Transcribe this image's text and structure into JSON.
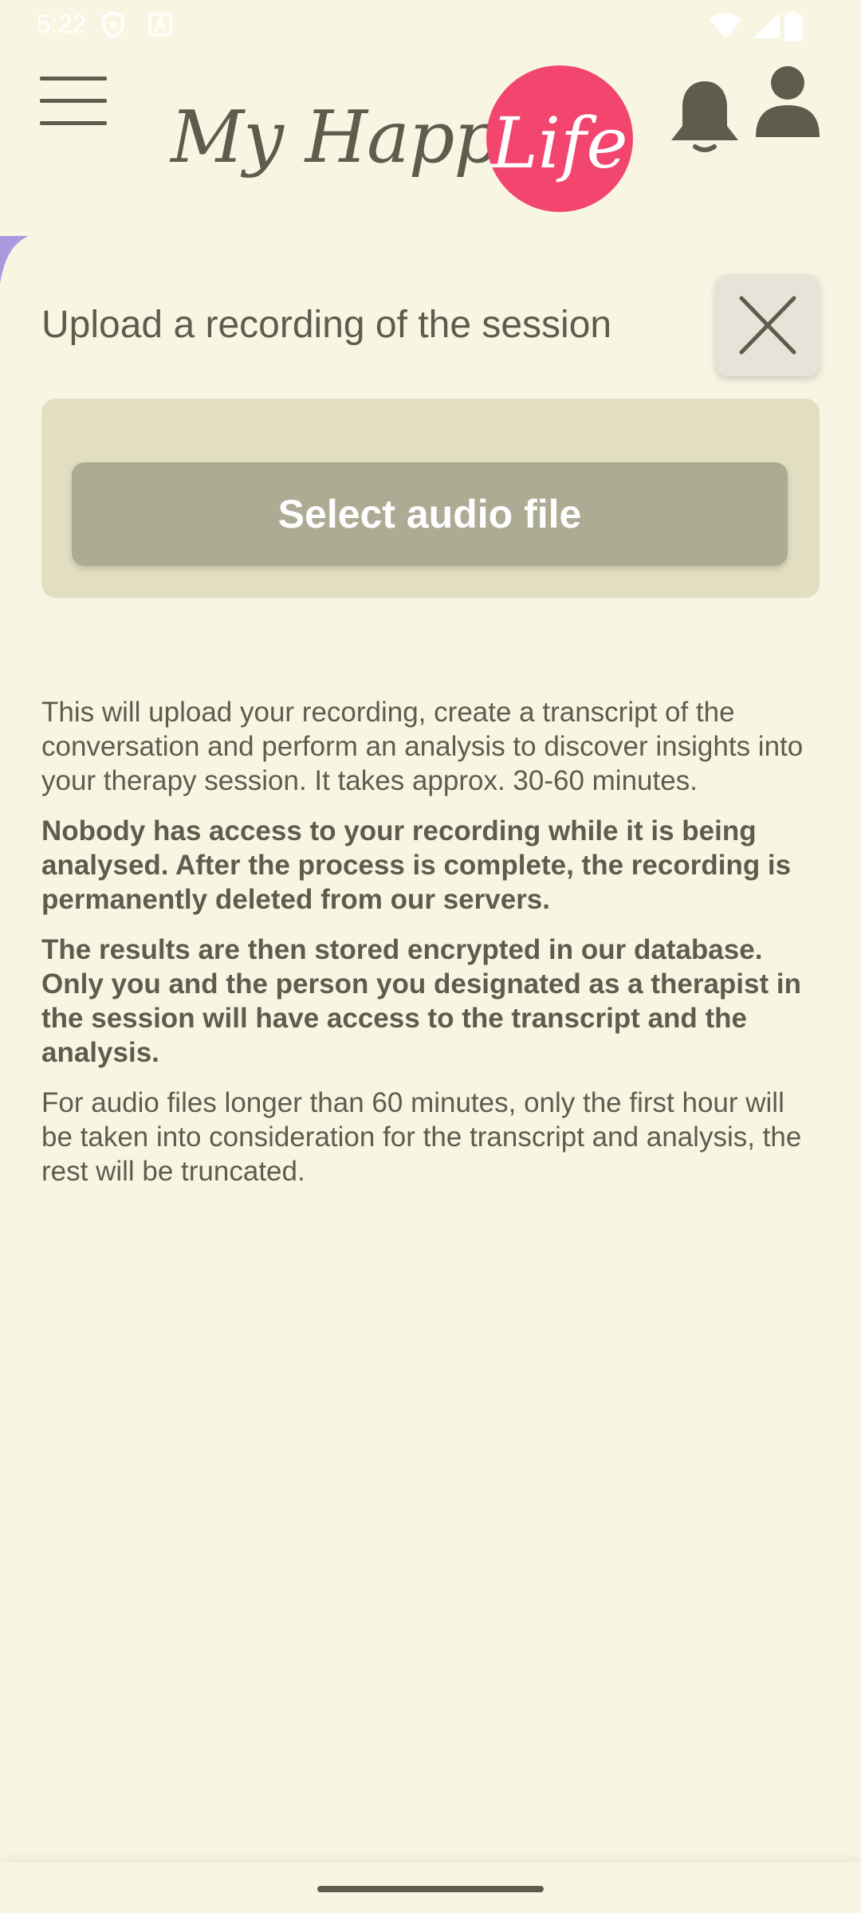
{
  "status_bar": {
    "time": "5:22",
    "icons": [
      "shield-icon",
      "a-icon",
      "wifi-icon",
      "signal-icon",
      "battery-icon"
    ]
  },
  "header": {
    "menu_icon": "hamburger-menu-icon",
    "logo_text": "My Happier",
    "logo_badge_text": "Life",
    "notifications_icon": "bell-icon",
    "profile_icon": "person-icon"
  },
  "panel": {
    "title": "Upload a recording of the session",
    "close_icon": "close-icon",
    "select_button_label": "Select audio file"
  },
  "description": {
    "p1": "This will upload your recording, create a transcript of the conversation and perform an analysis to discover insights into your therapy session. It takes approx. 30-60 minutes.",
    "p2": "Nobody has access to your recording while it is being analysed. After the process is complete, the recording is permanently deleted from our servers.",
    "p3": "The results are then stored encrypted in our database. Only you and the person you designated as a therapist in the session will have access to the transcript and the analysis.",
    "p4": "For audio files longer than 60 minutes, only the first hour will be taken into consideration for the transcript and analysis, the rest will be truncated."
  },
  "colors": {
    "background": "#f8f6e3",
    "text": "#5f5c4e",
    "brand_pink": "#f2466f",
    "card": "#e2dec1",
    "button": "#adab94",
    "accent_purple": "#a99ae0"
  }
}
